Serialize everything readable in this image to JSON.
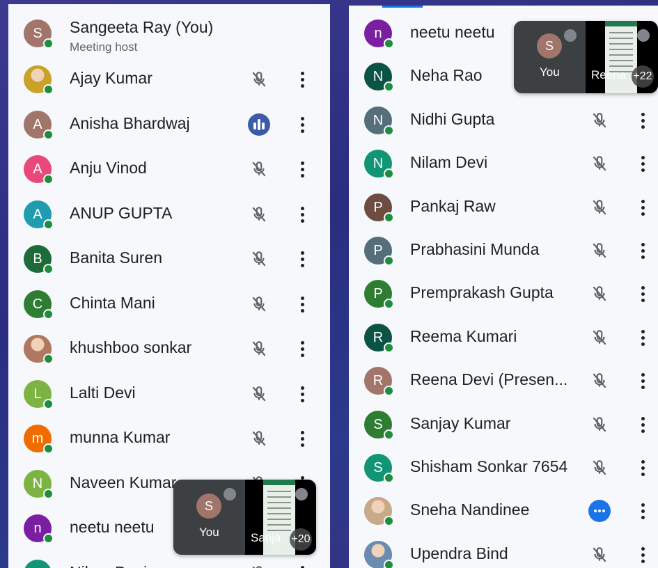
{
  "left_panel": {
    "host": {
      "initial": "S",
      "name": "Sangeeta Ray (You)",
      "role": "Meeting host",
      "color": "#a1756a"
    },
    "participants": [
      {
        "initial": "",
        "name": "Ajay Kumar",
        "color": "#c9a227",
        "photo": true,
        "status": "muted"
      },
      {
        "initial": "A",
        "name": "Anisha Bhardwaj",
        "color": "#a1756a",
        "status": "speaking"
      },
      {
        "initial": "A",
        "name": "Anju Vinod",
        "color": "#e8487a",
        "status": "muted"
      },
      {
        "initial": "A",
        "name": "ANUP GUPTA",
        "color": "#1f9cae",
        "status": "muted"
      },
      {
        "initial": "B",
        "name": "Banita Suren",
        "color": "#1e6b3a",
        "status": "muted"
      },
      {
        "initial": "C",
        "name": "Chinta Mani",
        "color": "#2e7d32",
        "status": "muted"
      },
      {
        "initial": "",
        "name": "khushboo sonkar",
        "color": "#b07860",
        "photo": true,
        "status": "muted"
      },
      {
        "initial": "L",
        "name": "Lalti Devi",
        "color": "#7cb342",
        "status": "muted"
      },
      {
        "initial": "m",
        "name": "munna Kumar",
        "color": "#ef6c00",
        "status": "muted"
      },
      {
        "initial": "N",
        "name": "Naveen Kumar",
        "color": "#7cb342",
        "status": "muted"
      },
      {
        "initial": "n",
        "name": "neetu neetu",
        "color": "#7b1fa2",
        "status": "none"
      },
      {
        "initial": "N",
        "name": "Nilam Devi",
        "color": "#129575",
        "status": "muted"
      }
    ],
    "tile": {
      "self_initial": "S",
      "self_label": "You",
      "share_label": "Sanja",
      "count": "+20"
    }
  },
  "right_panel": {
    "participants": [
      {
        "initial": "n",
        "name": "neetu neetu",
        "color": "#7b1fa2",
        "status": "none"
      },
      {
        "initial": "N",
        "name": "Neha Rao",
        "color": "#0b5345",
        "status": "none"
      },
      {
        "initial": "N",
        "name": "Nidhi Gupta",
        "color": "#546e7a",
        "status": "muted"
      },
      {
        "initial": "N",
        "name": "Nilam Devi",
        "color": "#129575",
        "status": "muted"
      },
      {
        "initial": "P",
        "name": "Pankaj Raw",
        "color": "#6d4c41",
        "status": "muted"
      },
      {
        "initial": "P",
        "name": "Prabhasini Munda",
        "color": "#546e7a",
        "status": "muted"
      },
      {
        "initial": "P",
        "name": "Premprakash Gupta",
        "color": "#2e7d32",
        "status": "muted"
      },
      {
        "initial": "R",
        "name": "Reema Kumari",
        "color": "#0b5345",
        "status": "muted"
      },
      {
        "initial": "R",
        "name": "Reena Devi (Presen...",
        "color": "#a1756a",
        "status": "muted"
      },
      {
        "initial": "S",
        "name": "Sanjay Kumar",
        "color": "#2e7d32",
        "status": "muted"
      },
      {
        "initial": "S",
        "name": "Shisham Sonkar 7654",
        "color": "#129575",
        "status": "muted"
      },
      {
        "initial": "",
        "name": "Sneha Nandinee",
        "color": "#c8a98a",
        "photo": true,
        "status": "more"
      },
      {
        "initial": "",
        "name": "Upendra Bind",
        "color": "#6a8cb0",
        "photo": true,
        "status": "muted"
      }
    ],
    "tile": {
      "self_initial": "S",
      "self_label": "You",
      "share_label": "Reena",
      "count": "+22"
    }
  }
}
